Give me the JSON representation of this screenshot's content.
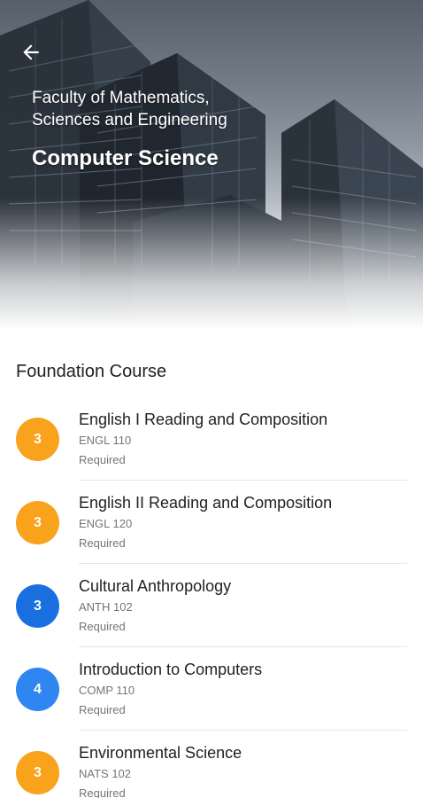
{
  "header": {
    "faculty_line1": "Faculty of Mathematics,",
    "faculty_line2": "Sciences and Engineering",
    "program": "Computer Science",
    "back_icon": "arrow-left-icon"
  },
  "section": {
    "title": "Foundation Course"
  },
  "courses": [
    {
      "credits": "3",
      "name": "English I Reading and Composition",
      "code": "ENGL 110",
      "status": "Required",
      "color": "#F9A21B"
    },
    {
      "credits": "3",
      "name": "English II Reading and Composition",
      "code": "ENGL 120",
      "status": "Required",
      "color": "#F9A21B"
    },
    {
      "credits": "3",
      "name": "Cultural Anthropology",
      "code": "ANTH 102",
      "status": "Required",
      "color": "#1A6FE0"
    },
    {
      "credits": "4",
      "name": "Introduction to Computers",
      "code": "COMP 110",
      "status": "Required",
      "color": "#2F86F0"
    },
    {
      "credits": "3",
      "name": "Environmental Science",
      "code": "NATS 102",
      "status": "Required",
      "color": "#F9A21B"
    }
  ]
}
